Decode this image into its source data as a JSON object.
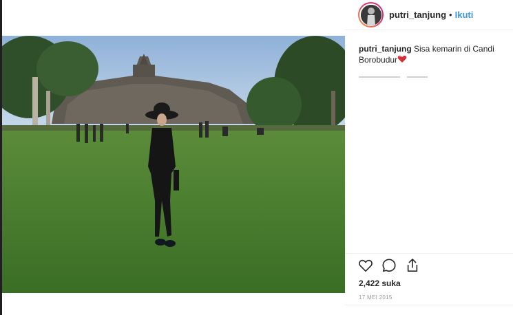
{
  "post": {
    "username": "putri_tanjung",
    "separator": "•",
    "follow_label": "Ikuti",
    "caption_user": "putri_tanjung",
    "caption_text": "Sisa kemarin di Candi Borobudur",
    "likes": "2,422 suka",
    "date": "17 MEI 2015"
  },
  "icons": {
    "like": "heart-icon",
    "comment": "comment-icon",
    "share": "share-icon",
    "caption_emoji": "red-heart-emoji"
  },
  "colors": {
    "follow": "#3897f0",
    "text": "#262626",
    "muted": "#999999",
    "sky": "#a9c4e0",
    "grass": "#3e7a2a",
    "emoji_heart": "#d62f3a"
  }
}
